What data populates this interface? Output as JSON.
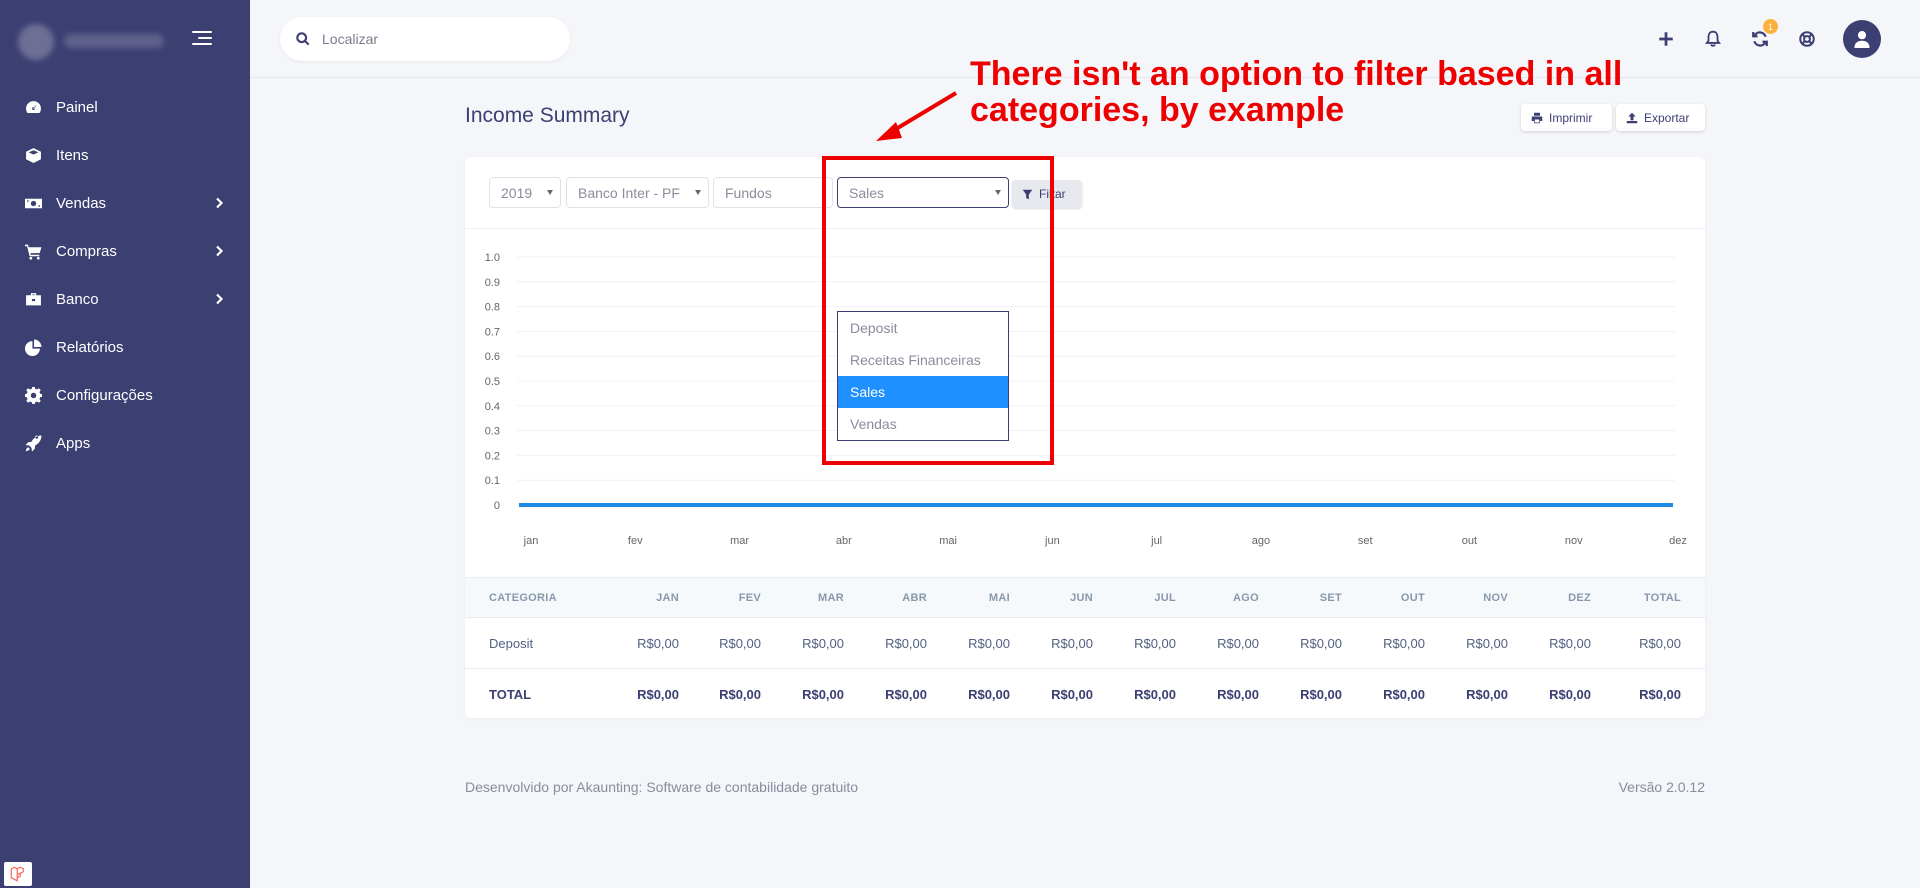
{
  "sidebar": {
    "items": [
      {
        "label": "Painel",
        "icon": "gauge-icon",
        "chevron": false
      },
      {
        "label": "Itens",
        "icon": "cube-icon",
        "chevron": false
      },
      {
        "label": "Vendas",
        "icon": "money-bill-icon",
        "chevron": true
      },
      {
        "label": "Compras",
        "icon": "cart-icon",
        "chevron": true
      },
      {
        "label": "Banco",
        "icon": "briefcase-icon",
        "chevron": true
      },
      {
        "label": "Relatórios",
        "icon": "pie-chart-icon",
        "chevron": false
      },
      {
        "label": "Configurações",
        "icon": "cog-icon",
        "chevron": false
      },
      {
        "label": "Apps",
        "icon": "rocket-icon",
        "chevron": false
      }
    ]
  },
  "topbar": {
    "search_placeholder": "Localizar",
    "sync_badge": "1"
  },
  "page": {
    "title": "Income Summary",
    "print_label": "Imprimir",
    "export_label": "Exportar"
  },
  "filters": {
    "year": "2019",
    "account": "Banco Inter - PF",
    "customer": "Fundos",
    "category": "Sales",
    "filter_label": "Filtar"
  },
  "dropdown": {
    "options": [
      "Deposit",
      "Receitas Financeiras",
      "Sales",
      "Vendas"
    ],
    "selected": "Sales"
  },
  "colors": {
    "sidebar_bg": "#3c3f72",
    "line": "#1e88e5",
    "annotation": "#ee0000",
    "dropdown_selected": "#1e90ff"
  },
  "chart_data": {
    "type": "line",
    "x": [
      "jan",
      "fev",
      "mar",
      "abr",
      "mai",
      "jun",
      "jul",
      "ago",
      "set",
      "out",
      "nov",
      "dez"
    ],
    "series": [
      {
        "values": [
          0,
          0,
          0,
          0,
          0,
          0,
          0,
          0,
          0,
          0,
          0,
          0
        ]
      }
    ],
    "yticks": [
      "0",
      "0.1",
      "0.2",
      "0.3",
      "0.4",
      "0.5",
      "0.6",
      "0.7",
      "0.8",
      "0.9",
      "1.0"
    ],
    "ylim": [
      0,
      1.0
    ],
    "grid": true
  },
  "table": {
    "headers": [
      "CATEGORIA",
      "JAN",
      "FEV",
      "MAR",
      "ABR",
      "MAI",
      "JUN",
      "JUL",
      "AGO",
      "SET",
      "OUT",
      "NOV",
      "DEZ",
      "TOTAL"
    ],
    "rows": [
      {
        "cells": [
          "Deposit",
          "R$0,00",
          "R$0,00",
          "R$0,00",
          "R$0,00",
          "R$0,00",
          "R$0,00",
          "R$0,00",
          "R$0,00",
          "R$0,00",
          "R$0,00",
          "R$0,00",
          "R$0,00",
          "R$0,00"
        ]
      }
    ],
    "total": {
      "cells": [
        "TOTAL",
        "R$0,00",
        "R$0,00",
        "R$0,00",
        "R$0,00",
        "R$0,00",
        "R$0,00",
        "R$0,00",
        "R$0,00",
        "R$0,00",
        "R$0,00",
        "R$0,00",
        "R$0,00",
        "R$0,00"
      ]
    }
  },
  "footer": {
    "left": "Desenvolvido por Akaunting: Software de contabilidade gratuito",
    "right": "Versão 2.0.12"
  },
  "annotation": {
    "text": "There isn't an option to filter based in all categories, by example"
  }
}
